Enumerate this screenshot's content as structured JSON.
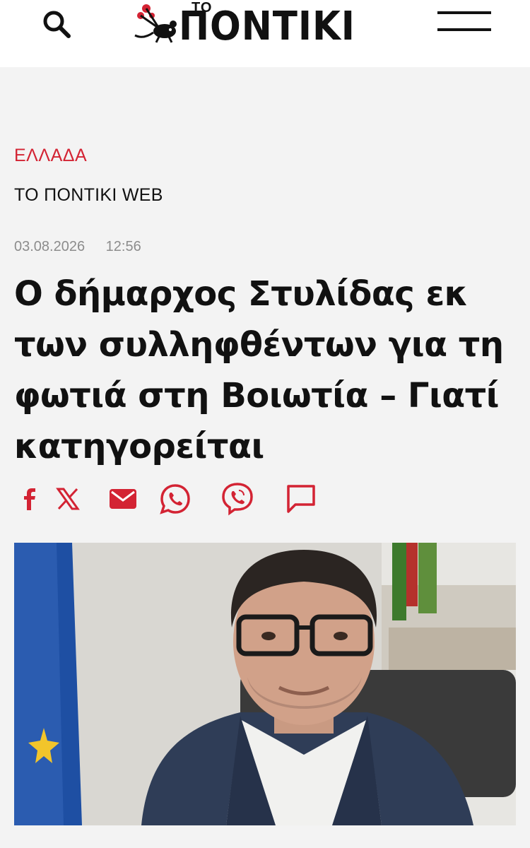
{
  "header": {
    "logo_small": "ΤΟ",
    "logo_main": "ΠΟΝΤΙΚΙ",
    "search_icon": "search-icon",
    "menu_icon": "hamburger-menu-icon"
  },
  "article": {
    "category": "ΕΛΛΑΔΑ",
    "author": "ΤΟ ΠΟΝΤΙΚΙ WEB",
    "date": "03.08.2026",
    "time": "12:56",
    "title": "Ο δήμαρχος Στυλίδας εκ των συλληφθέντων για τη φωτιά στη Βοιωτία – Γιατί κατηγορείται"
  },
  "share": [
    {
      "icon": "facebook-icon"
    },
    {
      "icon": "x-twitter-icon"
    },
    {
      "icon": "email-icon"
    },
    {
      "icon": "whatsapp-icon"
    },
    {
      "icon": "viber-icon"
    },
    {
      "icon": "comment-icon"
    }
  ],
  "colors": {
    "accent": "#d32333",
    "background": "#f3f3f3",
    "meta_text": "#8c8c8c"
  }
}
